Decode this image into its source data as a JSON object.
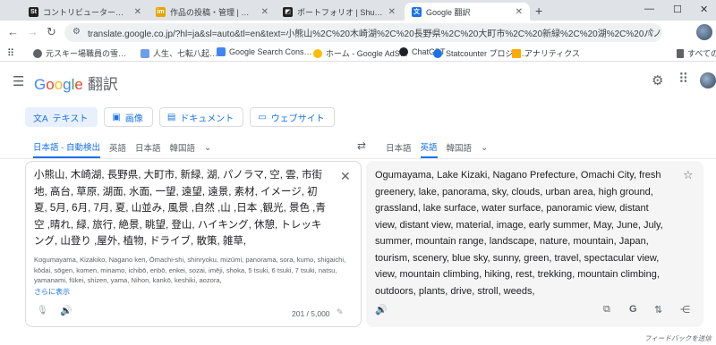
{
  "browser": {
    "tabs": [
      {
        "title": "コントリビューターの投稿播出：レビ…",
        "favicon": "St",
        "color": "#202124"
      },
      {
        "title": "作品の投稿・管理 | イメージマート",
        "favicon": "im",
        "color": "#e8a400"
      },
      {
        "title": "ポートフォリオ | Shutterstock",
        "favicon": "◩",
        "color": "#202124"
      },
      {
        "title": "Google 翻訳",
        "favicon": "文",
        "color": "#1a73e8"
      }
    ],
    "url": "translate.google.co.jp/?hl=ja&sl=auto&tl=en&text=小熊山%2C%20木崎湖%2C%20長野県%2C%20大町市%2C%20新緑%2C%20湖%2C%20パノラマ%2C%20空%2C%2…",
    "bookmarks": [
      {
        "label": "元スキー場職員の雪…",
        "color": "#f4a142"
      },
      {
        "label": "人生、七転八起…",
        "color": "#6d9eeb"
      },
      {
        "label": "Google Search Cons…",
        "color": "#4285f4"
      },
      {
        "label": "ホーム - Google AdS…",
        "color": "#fbbc05"
      },
      {
        "label": "ChatGPT",
        "color": "#202124"
      },
      {
        "label": "Statcounter プロジェ…",
        "color": "#1a73e8"
      },
      {
        "label": "アナリティクス",
        "color": "#f9ab00"
      }
    ],
    "all_bookmarks": "すべてのブ"
  },
  "app": {
    "logo_letters": [
      "G",
      "o",
      "o",
      "g",
      "l",
      "e"
    ],
    "product": "翻訳"
  },
  "modes": [
    {
      "label": "テキスト",
      "icon": "文A"
    },
    {
      "label": "画像",
      "icon": "▣"
    },
    {
      "label": "ドキュメント",
      "icon": "▤"
    },
    {
      "label": "ウェブサイト",
      "icon": "▭"
    }
  ],
  "source_langs": [
    "日本語 - 自動検出",
    "英語",
    "日本語",
    "韓国語"
  ],
  "target_langs": [
    "日本語",
    "英語",
    "韓国語"
  ],
  "source_text": "小熊山, 木崎湖, 長野県, 大町市, 新緑, 湖, パノラマ, 空, 雲, 市街地, 高台, 草原, 湖面, 水面, 一望, 遠望, 遠景, 素材, イメージ, 初夏, 5月, 6月, 7月, 夏, 山並み, 風景 ,自然 ,山 ,日本 ,観光, 景色 ,青空 ,晴れ, 緑, 旅行, 絶景, 眺望, 登山, ハイキング, 休憩, トレッキング, 山登り ,屋外, 植物, ドライブ, 散策, 雑草,",
  "transliteration": "Kogumayama, Kizakiko, Nagano ken, Ōmachi-shi, shinryoku, mizūmi, panorama, sora, kumo, shigaichi, kōdai, sōgen, komen, minamo, ichibō, enbō, enkei, sozai, imēji, shoka, 5 tsuki, 6 tsuki, 7 tsuki, natsu, yamanami, fūkei, shizen, yama, Nihon, kankō, keshiki, aozora,",
  "show_more": "さらに表示",
  "char_count": "201 / 5,000",
  "translated_text": "Ogumayama, Lake Kizaki, Nagano Prefecture, Omachi City, fresh greenery, lake, panorama, sky, clouds, urban area, high ground, grassland, lake surface, water surface, panoramic view, distant view, distant view, material, image, early summer, May, June, July, summer, mountain range, landscape, nature, mountain, Japan, tourism, scenery, blue sky, sunny, green, travel, spectacular view, view, mountain climbing, hiking, rest, trekking, mountain climbing, outdoors, plants, drive, stroll, weeds,",
  "feedback": "フィードバックを送信"
}
